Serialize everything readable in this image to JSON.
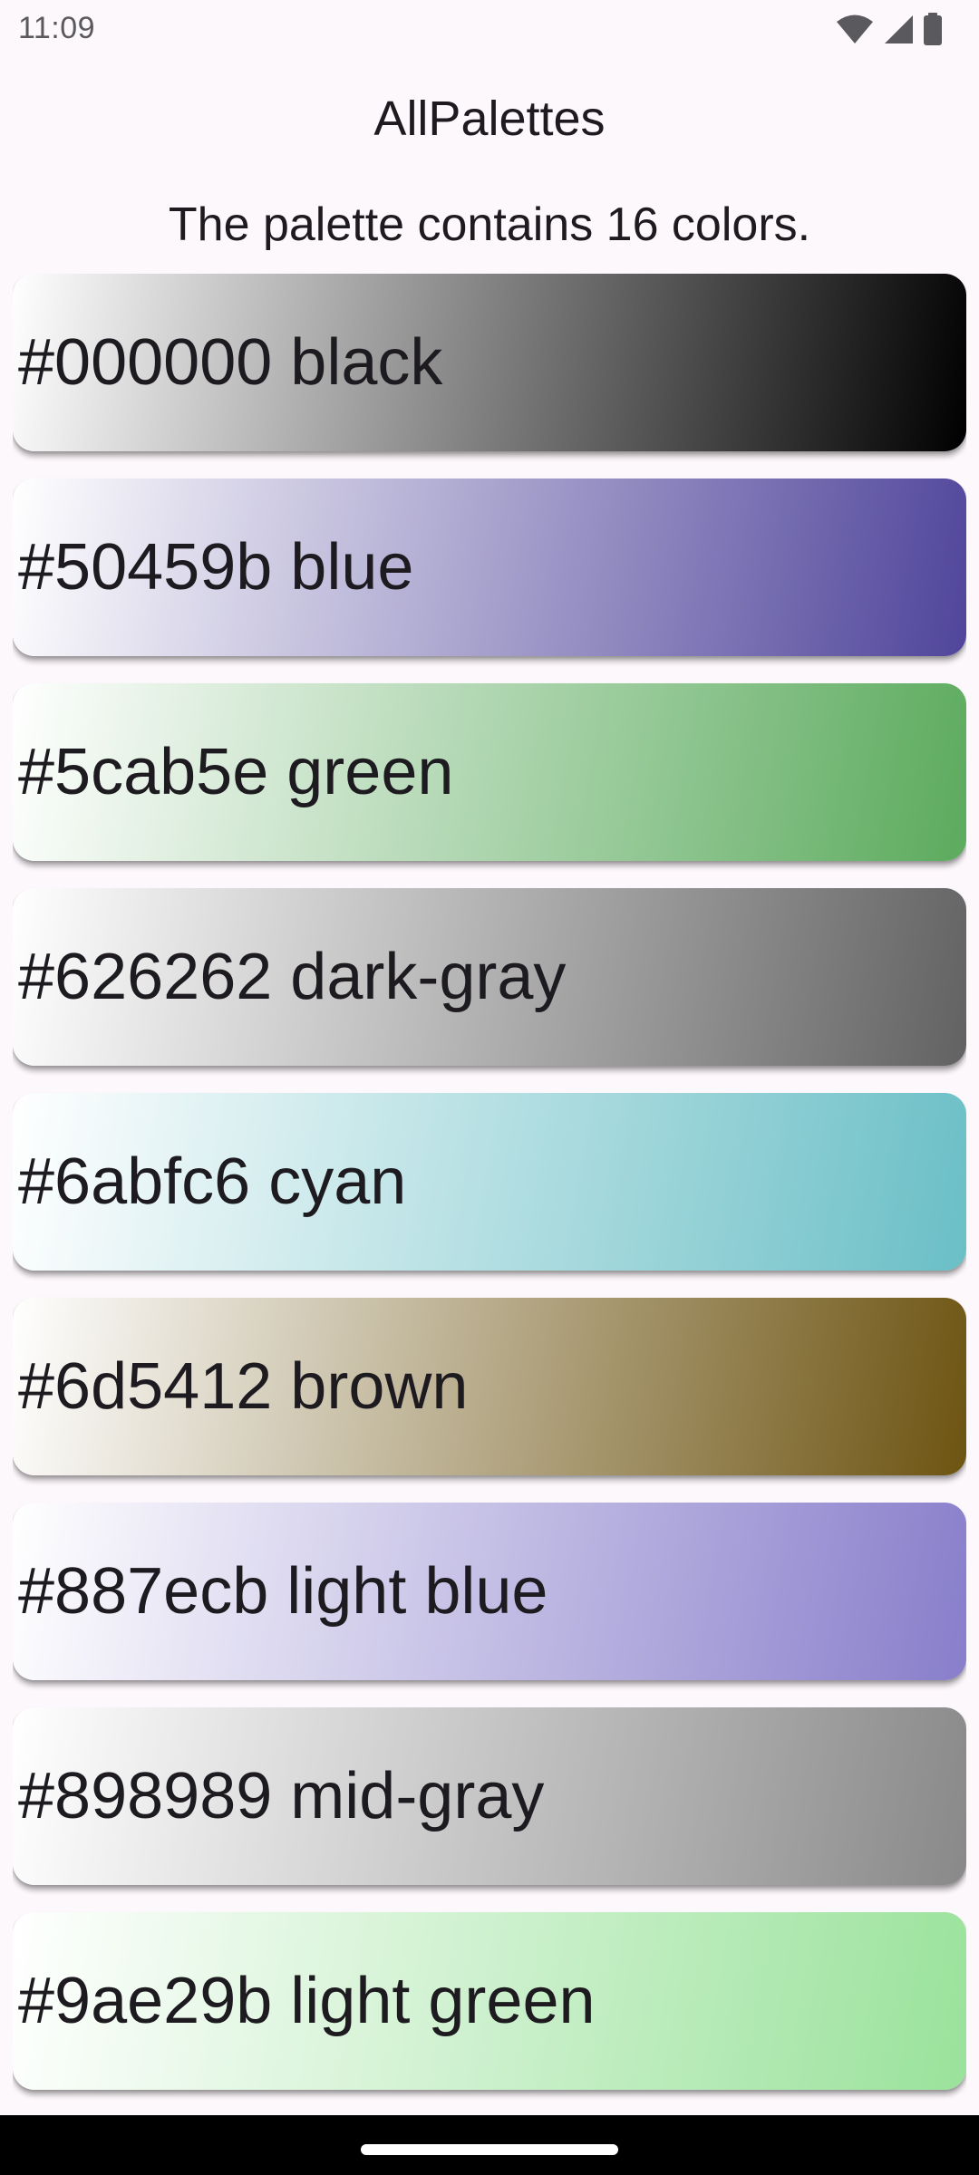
{
  "status_bar": {
    "time": "11:09",
    "icons": [
      "wifi-icon",
      "signal-icon",
      "battery-icon"
    ]
  },
  "app": {
    "title": "AllPalettes",
    "subtitle": "The palette contains 16 colors."
  },
  "palette": {
    "colors": [
      {
        "label": "#000000 black",
        "hex": "#000000"
      },
      {
        "label": "#50459b blue",
        "hex": "#50459b"
      },
      {
        "label": "#5cab5e green",
        "hex": "#5cab5e"
      },
      {
        "label": "#626262 dark-gray",
        "hex": "#626262"
      },
      {
        "label": "#6abfc6 cyan",
        "hex": "#6abfc6"
      },
      {
        "label": "#6d5412 brown",
        "hex": "#6d5412"
      },
      {
        "label": "#887ecb light blue",
        "hex": "#887ecb"
      },
      {
        "label": "#898989 mid-gray",
        "hex": "#898989"
      },
      {
        "label": "#9ae29b light green",
        "hex": "#9ae29b"
      }
    ]
  }
}
